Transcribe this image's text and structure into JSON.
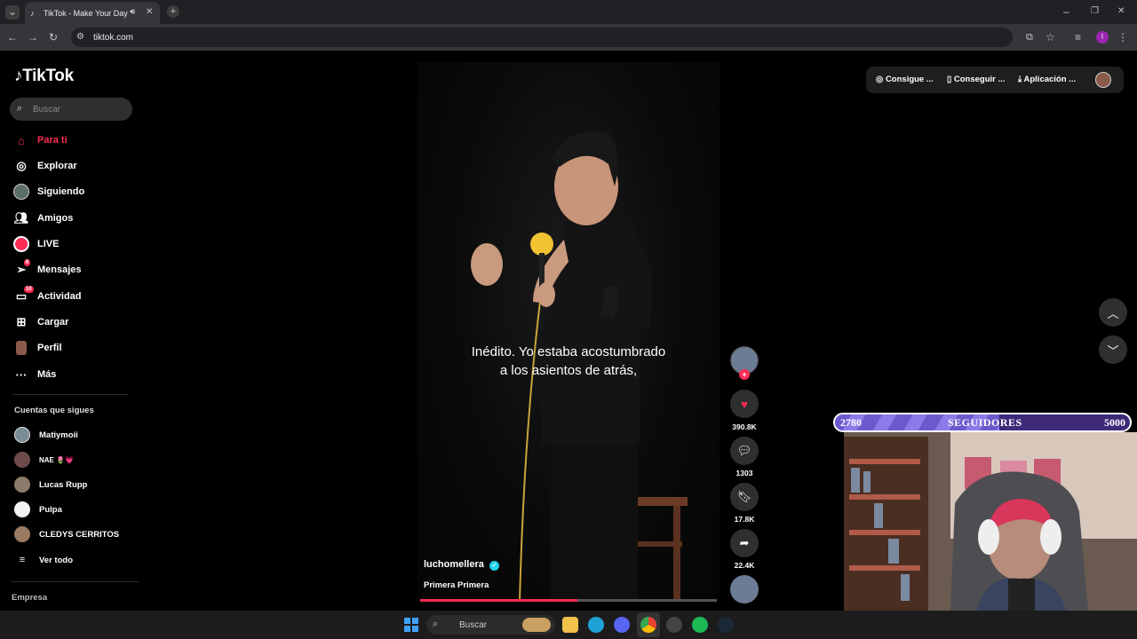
{
  "browser": {
    "tab_title": "TikTok - Make Your Day",
    "url": "tiktok.com",
    "profile_initial": "I"
  },
  "sidebar": {
    "logo": "TikTok",
    "search_placeholder": "Buscar",
    "nav": [
      {
        "label": "Para ti",
        "icon": "home-icon",
        "active": true
      },
      {
        "label": "Explorar",
        "icon": "compass-icon"
      },
      {
        "label": "Siguiendo",
        "icon": "following-avatar-icon"
      },
      {
        "label": "Amigos",
        "icon": "friends-icon"
      },
      {
        "label": "LIVE",
        "icon": "live-icon"
      },
      {
        "label": "Mensajes",
        "icon": "messages-icon",
        "badge": "6"
      },
      {
        "label": "Actividad",
        "icon": "activity-icon",
        "badge": "10"
      },
      {
        "label": "Cargar",
        "icon": "upload-icon"
      },
      {
        "label": "Perfil",
        "icon": "profile-icon"
      },
      {
        "label": "Más",
        "icon": "more-icon"
      }
    ],
    "following_title": "Cuentas que sigues",
    "accounts": [
      {
        "name": "Matiymoii"
      },
      {
        "name": "NAE 🌷💗"
      },
      {
        "name": "Lucas Rupp"
      },
      {
        "name": "Pulpa"
      },
      {
        "name": "CLEDYS CERRITOS"
      }
    ],
    "see_all": "Ver todo",
    "footer": "Empresa"
  },
  "topbar": {
    "coins": "Consigue ...",
    "get_app": "Conseguir ...",
    "download": "Aplicación ..."
  },
  "video": {
    "subtitle_line1": "Inédito. Yo estaba acostumbrado",
    "subtitle_line2": "a los asientos de atrás,",
    "author": "luchomellera",
    "description": "Primera Primera",
    "progress": 0.53,
    "likes": "390.8K",
    "comments": "1303",
    "saves": "17.8K",
    "shares": "22.4K"
  },
  "overlay": {
    "followers_current": "2780",
    "followers_label": "SEGUIDORES",
    "followers_goal": "5000",
    "accent": "#6a5acd"
  },
  "taskbar": {
    "search_placeholder": "Buscar"
  },
  "colors": {
    "brand": "#fe2c55",
    "panel": "#2f2f2f"
  }
}
